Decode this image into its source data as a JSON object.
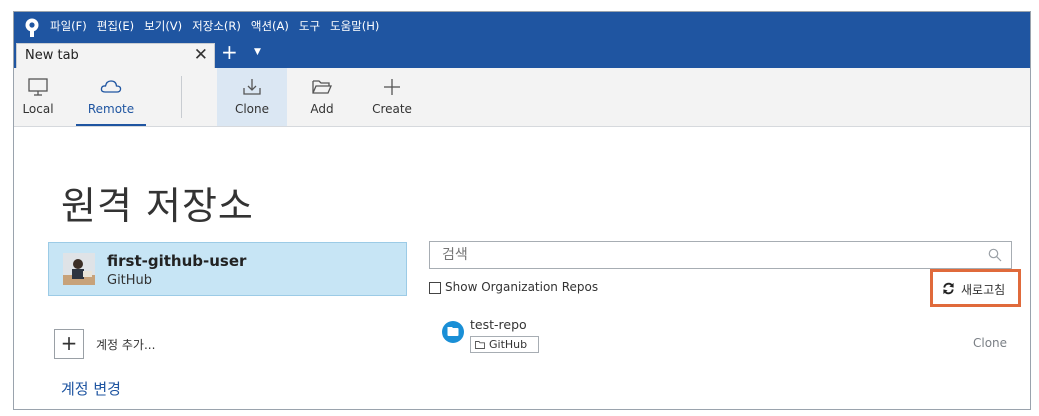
{
  "menu": {
    "file": "파일(F)",
    "edit": "편집(E)",
    "view": "보기(V)",
    "repository": "저장소(R)",
    "action": "액션(A)",
    "tools": "도구",
    "help": "도움말(H)"
  },
  "tabs": [
    {
      "label": "New tab",
      "close": "✕"
    }
  ],
  "tabstrip": {
    "new_tab": "+",
    "menu": "▼"
  },
  "toolbar": {
    "local": "Local",
    "remote": "Remote",
    "clone": "Clone",
    "add": "Add",
    "create": "Create"
  },
  "main": {
    "title": "원격 저장소",
    "account": {
      "name": "first-github-user",
      "host": "GitHub"
    },
    "add_account": {
      "icon": "+",
      "label": "계정 추가..."
    },
    "change_account": "계정 변경",
    "search": {
      "placeholder": "검색"
    },
    "show_org_repos": "Show Organization Repos",
    "refresh": "새로고침",
    "repos": [
      {
        "name": "test-repo",
        "host": "GitHub",
        "action": "Clone"
      }
    ]
  },
  "colors": {
    "titlebar": "#1f55a1",
    "accent": "#1f55a1",
    "selected_card": "#c7e5f5",
    "highlight_border": "#e06a3b"
  }
}
